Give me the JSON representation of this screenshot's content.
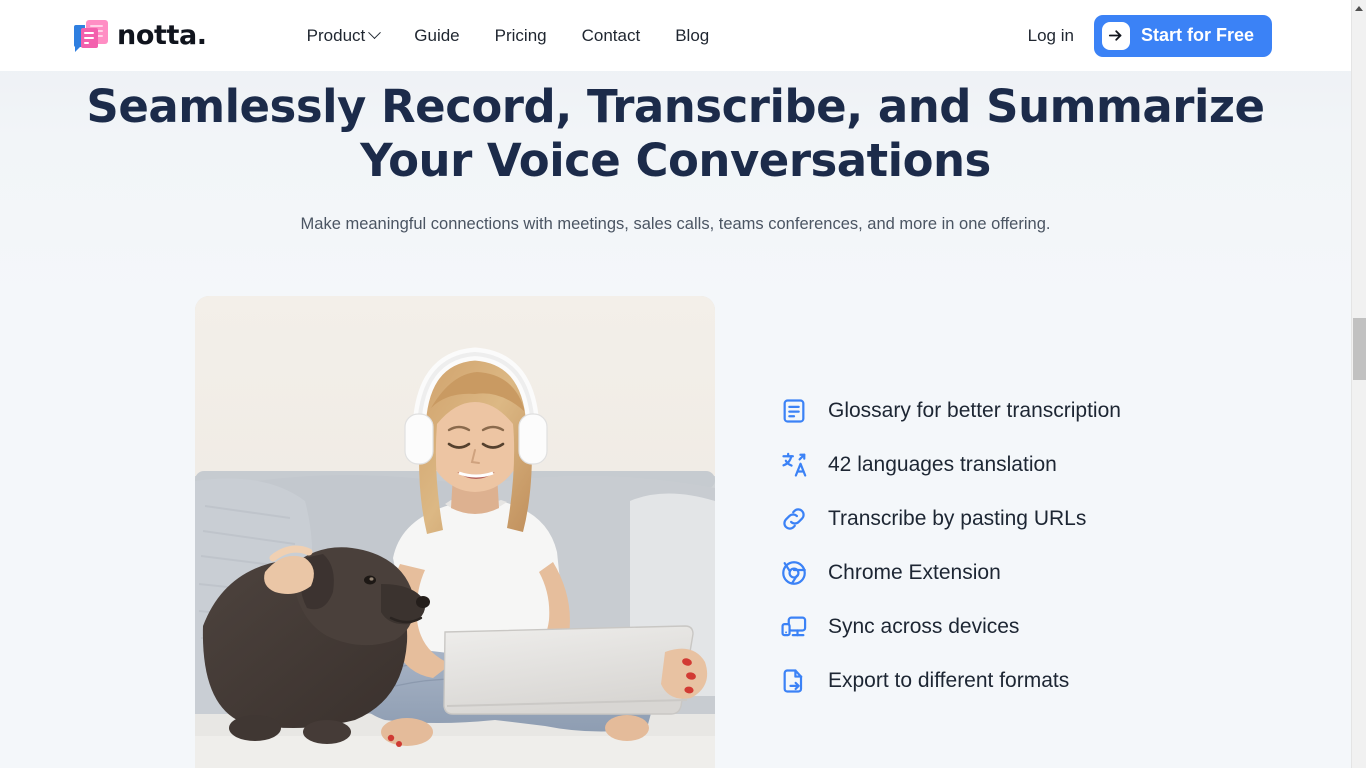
{
  "brand": {
    "name": "notta.",
    "logo_icon": "notta-logo-icon",
    "accent_blue": "#3b82f6",
    "logo_pink": "#f360ad",
    "logo_blue": "#2f7fe0"
  },
  "nav": {
    "items": [
      {
        "label": "Product",
        "has_dropdown": true
      },
      {
        "label": "Guide",
        "has_dropdown": false
      },
      {
        "label": "Pricing",
        "has_dropdown": false
      },
      {
        "label": "Contact",
        "has_dropdown": false
      },
      {
        "label": "Blog",
        "has_dropdown": false
      }
    ],
    "login_label": "Log in",
    "cta_label": "Start for Free",
    "cta_icon": "arrow-right-icon",
    "cta_bg": "#3b82f6"
  },
  "hero": {
    "title": "Seamlessly Record, Transcribe, and Summarize Your Voice Conversations",
    "subtitle": "Make meaningful connections with meetings, sales calls, teams conferences, and more in one offering.",
    "title_color": "#1c2b4a",
    "subtitle_color": "#4b5563",
    "image_alt": "Woman wearing white headphones sitting cross-legged on a rug with a laptop, petting a dark grey dog in front of a light grey sofa"
  },
  "features": [
    {
      "icon": "document-lines-icon",
      "label": "Glossary for better transcription"
    },
    {
      "icon": "translate-icon",
      "label": "42 languages translation"
    },
    {
      "icon": "link-icon",
      "label": "Transcribe by pasting URLs"
    },
    {
      "icon": "chrome-icon",
      "label": "Chrome Extension"
    },
    {
      "icon": "devices-sync-icon",
      "label": "Sync across devices"
    },
    {
      "icon": "file-export-icon",
      "label": "Export to different formats"
    }
  ],
  "scrollbar": {
    "up_arrow_icon": "scroll-up-arrow-icon",
    "thumb_label": "scroll-thumb"
  }
}
